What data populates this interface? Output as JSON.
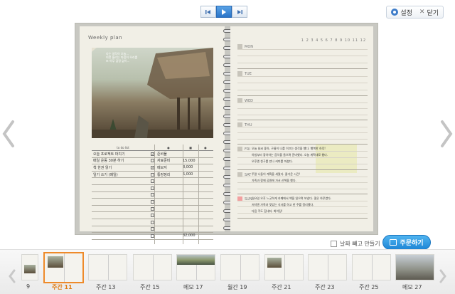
{
  "toolbar": {
    "settings_label": "설정",
    "close_label": "닫기"
  },
  "left_page": {
    "title": "Weekly plan",
    "photo_caption": [
      "다는 생각이 오늘...",
      "이런 돌리는 마음이 우리를",
      "또 아무 감정 없이..."
    ],
    "todo_header": [
      "to do list",
      "●",
      "■",
      "●"
    ],
    "todo_rows": [
      {
        "text": "오늘 프로젝트 마치기",
        "checked": true,
        "c1": "준비물",
        "c2": ""
      },
      {
        "text": "매일 운동 30분 하기",
        "checked": false,
        "c1": "자료준비",
        "c2": "15,000"
      },
      {
        "text": "책 한권 읽기",
        "checked": true,
        "c1": "메모지",
        "c2": "8,000"
      },
      {
        "text": "일기 쓰기 (매일)",
        "checked": false,
        "c1": "통장정리",
        "c2": "5,000"
      },
      {
        "text": "",
        "checked": false,
        "c1": "",
        "c2": ""
      },
      {
        "text": "",
        "checked": false,
        "c1": "",
        "c2": ""
      },
      {
        "text": "",
        "checked": false,
        "c1": "",
        "c2": ""
      },
      {
        "text": "",
        "checked": false,
        "c1": "",
        "c2": ""
      },
      {
        "text": "",
        "checked": false,
        "c1": "",
        "c2": ""
      },
      {
        "text": "",
        "checked": false,
        "c1": "",
        "c2": ""
      },
      {
        "text": "",
        "checked": false,
        "c1": "",
        "c2": ""
      },
      {
        "text": "",
        "checked": false,
        "c1": "",
        "c2": ""
      },
      {
        "text": "",
        "checked": false,
        "c1": "",
        "c2": "32,000"
      }
    ]
  },
  "right_page": {
    "month_numbers": "1 2 3 4 5 6 7 8 9 10 11 12",
    "days": [
      {
        "label": "MON",
        "red": false,
        "notes": []
      },
      {
        "label": "TUE",
        "red": false,
        "notes": []
      },
      {
        "label": "WED",
        "red": false,
        "notes": []
      },
      {
        "label": "THU",
        "red": false,
        "notes": []
      },
      {
        "label": "FRI",
        "red": false,
        "notes": [
          "오늘 날씨 좋아, 구름이 나를 이끄는 생각을 했다. 행복한 하루!",
          "아침부터 좋아하는 음악을 들으며 준비했다. 오늘 계획대로 했다.",
          "오후엔 친구를 만나 커피를 마셨다."
        ]
      },
      {
        "label": "SAT",
        "red": false,
        "notes": [
          "주말 나들이 계획을 세웠다. 즐거운 시간!",
          "가족과 함께 공원에 가서 산책을 했다."
        ]
      },
      {
        "label": "SUN",
        "red": true,
        "notes": [
          "일요일 오후 느긋하게 카페에서 책을 읽으며 보냈다. 좋은 하루였다.",
          "저녁엔 가족과 맛있는 식사를 하고 한 주를 정리했다.",
          "다음 주도 힘내자. 화이팅!"
        ]
      }
    ]
  },
  "options": {
    "exclude_date_label": "날짜 빼고 만들기",
    "order_label": "주문하기"
  },
  "thumbnails": [
    {
      "label": "9",
      "active": false,
      "kind": "book"
    },
    {
      "label": "주간   11",
      "active": true,
      "kind": "weekly-photo"
    },
    {
      "label": "주간   13",
      "active": false,
      "kind": "blank"
    },
    {
      "label": "주간   15",
      "active": false,
      "kind": "blank"
    },
    {
      "label": "메모   17",
      "active": false,
      "kind": "crowd"
    },
    {
      "label": "월간   19",
      "active": false,
      "kind": "blank"
    },
    {
      "label": "주간   21",
      "active": false,
      "kind": "photo-left"
    },
    {
      "label": "주간   23",
      "active": false,
      "kind": "blank"
    },
    {
      "label": "주간   25",
      "active": false,
      "kind": "blank"
    },
    {
      "label": "메모   27",
      "active": false,
      "kind": "beach"
    }
  ],
  "colors": {
    "accent": "#2a74c8",
    "active_thumb": "#ee8a2a",
    "order_button": "#1f86d6"
  }
}
